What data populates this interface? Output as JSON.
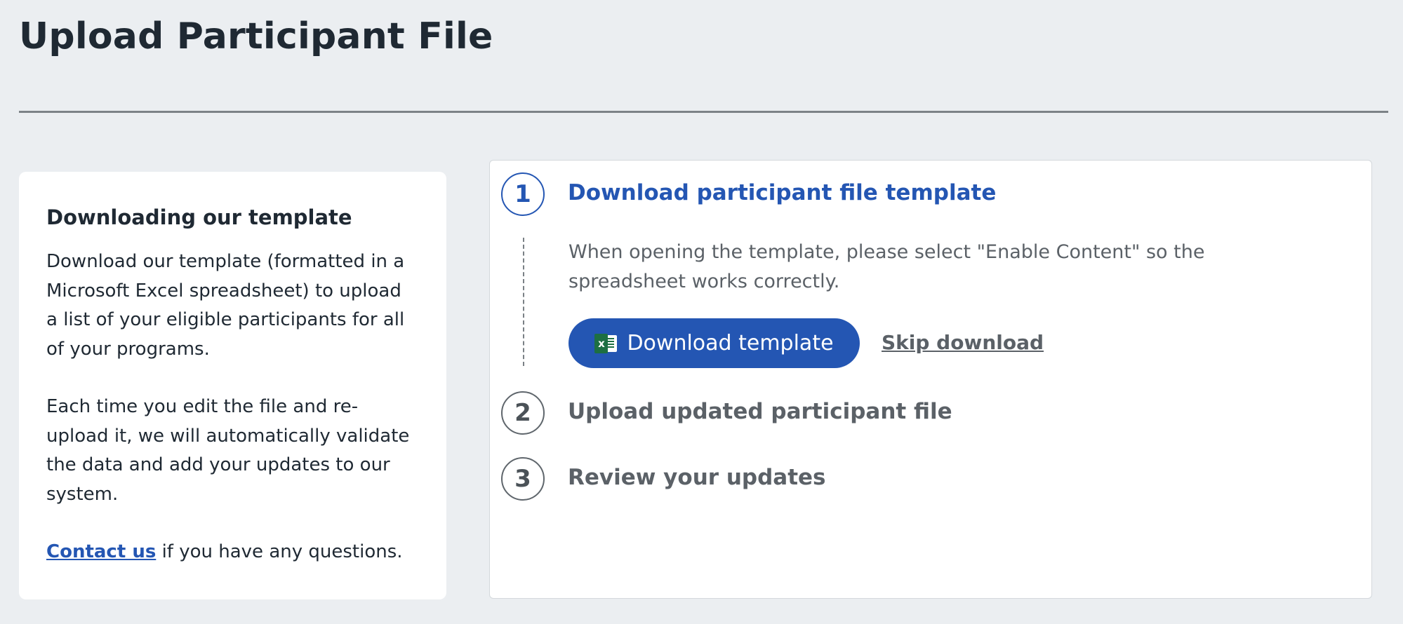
{
  "page": {
    "title": "Upload Participant File"
  },
  "info": {
    "heading": "Downloading our template",
    "paragraph1": "Download our template (formatted in a Microsoft Excel spreadsheet) to upload a list of your eligible participants for all of your programs.",
    "paragraph2": "Each time you edit the file and re-upload it, we will automatically validate the data and add your updates to our system.",
    "contact_link": "Contact us",
    "contact_suffix": " if you have any questions."
  },
  "steps": [
    {
      "number": "1",
      "title": "Download participant file template",
      "description": "When opening the template, please select \"Enable Content\" so the spreadsheet works correctly.",
      "primary_button": "Download template",
      "primary_button_icon": "excel-icon",
      "secondary_link": "Skip download"
    },
    {
      "number": "2",
      "title": "Upload updated participant file"
    },
    {
      "number": "3",
      "title": "Review your updates"
    }
  ],
  "colors": {
    "background": "#ebeef1",
    "accent": "#2456b3",
    "text_dark": "#1f2933",
    "text_muted": "#5b6167",
    "excel_green": "#1d6f42"
  }
}
